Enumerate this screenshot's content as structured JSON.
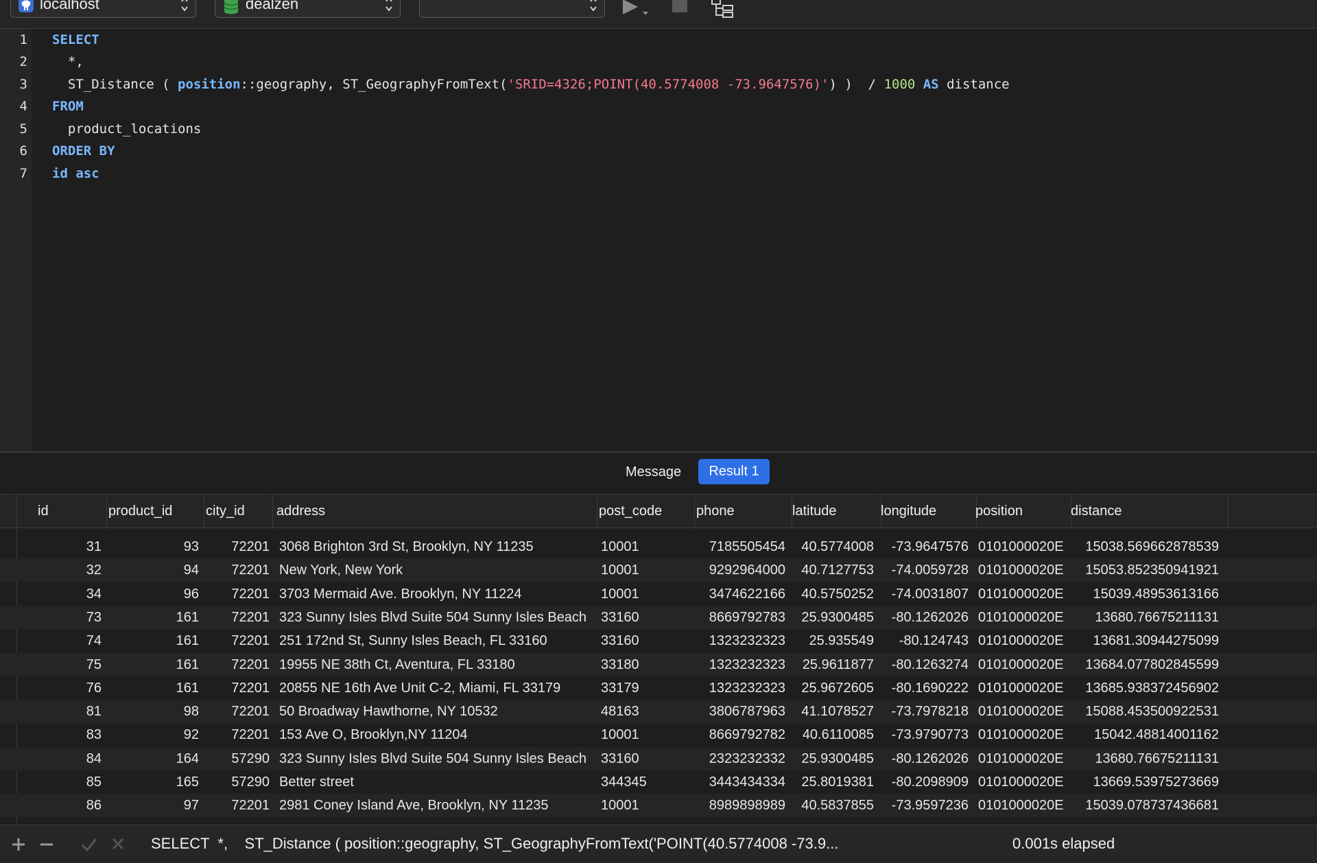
{
  "toolbar": {
    "connection": "localhost",
    "database": "dealzen",
    "schema": ""
  },
  "editor": {
    "line_numbers": [
      "1",
      "2",
      "3",
      "4",
      "5",
      "6",
      "7"
    ]
  },
  "results": {
    "tabs": [
      "Message",
      "Result 1"
    ],
    "active_tab": "Result 1",
    "columns": [
      "id",
      "product_id",
      "city_id",
      "address",
      "post_code",
      "phone",
      "latitude",
      "longitude",
      "position",
      "distance"
    ],
    "rows": [
      [
        "31",
        "93",
        "72201",
        "3068 Brighton 3rd St, Brooklyn, NY 11235",
        "10001",
        "7185505454",
        "40.5774008",
        "-73.9647576",
        "0101000020E",
        "15038.569662878539"
      ],
      [
        "32",
        "94",
        "72201",
        "New York, New York",
        "10001",
        "9292964000",
        "40.7127753",
        "-74.0059728",
        "0101000020E",
        "15053.852350941921"
      ],
      [
        "34",
        "96",
        "72201",
        "3703 Mermaid Ave. Brooklyn, NY 11224",
        "10001",
        "3474622166",
        "40.5750252",
        "-74.0031807",
        "0101000020E",
        "15039.48953613166"
      ],
      [
        "73",
        "161",
        "72201",
        "323 Sunny Isles Blvd Suite 504 Sunny Isles Beach",
        "33160",
        "8669792783",
        "25.9300485",
        "-80.1262026",
        "0101000020E",
        "13680.76675211131"
      ],
      [
        "74",
        "161",
        "72201",
        "251 172nd St, Sunny Isles Beach, FL 33160",
        "33160",
        "1323232323",
        "25.935549",
        "-80.124743",
        "0101000020E",
        "13681.30944275099"
      ],
      [
        "75",
        "161",
        "72201",
        "19955 NE 38th Ct, Aventura, FL 33180",
        "33180",
        "1323232323",
        "25.9611877",
        "-80.1263274",
        "0101000020E",
        "13684.077802845599"
      ],
      [
        "76",
        "161",
        "72201",
        "20855 NE 16th Ave Unit C-2, Miami, FL 33179",
        "33179",
        "1323232323",
        "25.9672605",
        "-80.1690222",
        "0101000020E",
        "13685.938372456902"
      ],
      [
        "81",
        "98",
        "72201",
        "50 Broadway Hawthorne, NY 10532",
        "48163",
        "3806787963",
        "41.1078527",
        "-73.7978218",
        "0101000020E",
        "15088.453500922531"
      ],
      [
        "83",
        "92",
        "72201",
        "153 Ave O, Brooklyn,NY 11204",
        "10001",
        "8669792782",
        "40.6110085",
        "-73.9790773",
        "0101000020E",
        "15042.48814001162"
      ],
      [
        "84",
        "164",
        "57290",
        "323 Sunny Isles Blvd Suite 504 Sunny Isles Beach",
        "33160",
        "2323232332",
        "25.9300485",
        "-80.1262026",
        "0101000020E",
        "13680.76675211131"
      ],
      [
        "85",
        "165",
        "57290",
        "Better street",
        "344345",
        "3443434334",
        "25.8019381",
        "-80.2098909",
        "0101000020E",
        "13669.53975273669"
      ],
      [
        "86",
        "97",
        "72201",
        "2981 Coney Island Ave, Brooklyn, NY 11235",
        "10001",
        "8989898989",
        "40.5837855",
        "-73.9597236",
        "0101000020E",
        "15039.078737436681"
      ]
    ]
  },
  "status": {
    "sql_preview": "SELECT  *,    ST_Distance ( position::geography, ST_GeographyFromText('POINT(40.5774008 -73.9...",
    "elapsed": "0.001s elapsed"
  },
  "colors": {
    "accent": "#2e6fe6",
    "keyword": "#79b8ff",
    "string": "#f47a8e",
    "number": "#b5e48c"
  }
}
